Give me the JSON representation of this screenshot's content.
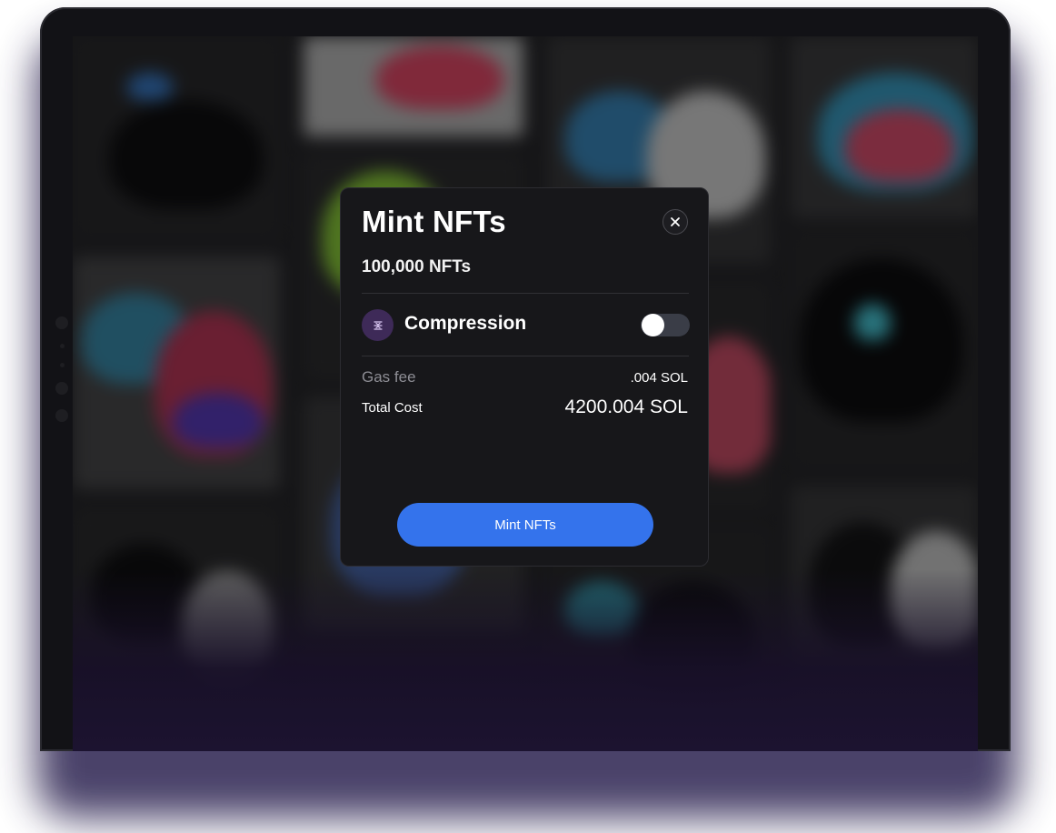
{
  "modal": {
    "title": "Mint NFTs",
    "count_label": "100,000 NFTs",
    "compression": {
      "label": "Compression",
      "icon": "compress-icon",
      "enabled": false
    },
    "gas_fee": {
      "label": "Gas fee",
      "value": ".004 SOL"
    },
    "total_cost": {
      "label": "Total Cost",
      "value": "4200.004 SOL"
    },
    "primary_button_label": "Mint NFTs",
    "close_icon": "close-icon"
  },
  "colors": {
    "accent": "#3473ec",
    "modal_bg": "#17171a",
    "compression_icon_bg": "#3e2a58",
    "backdrop_glow": "#2b2250"
  }
}
